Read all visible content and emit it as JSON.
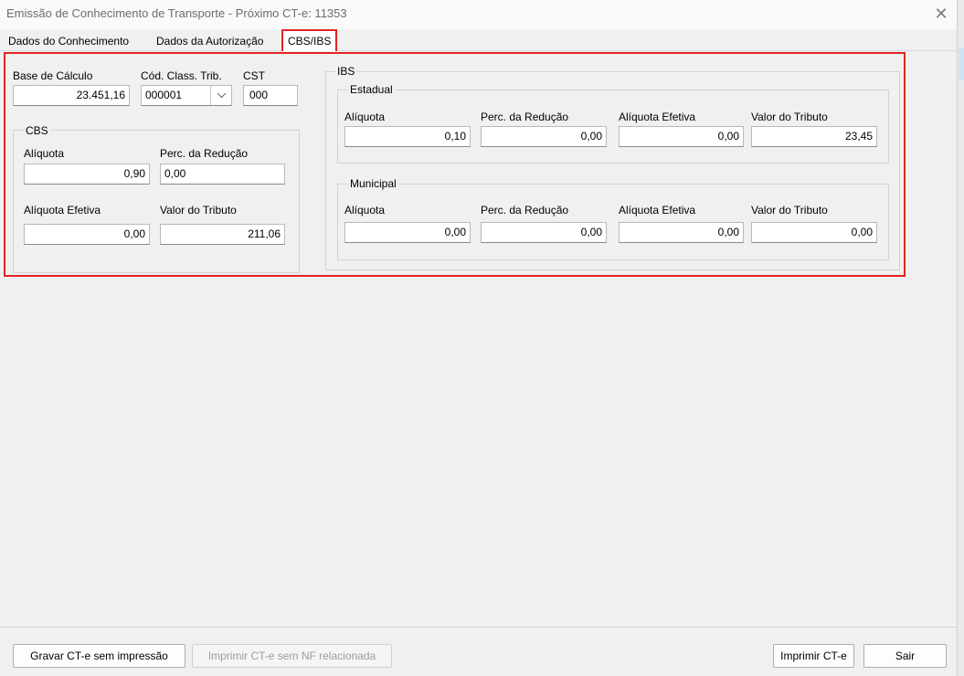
{
  "window": {
    "title": "Emissão de Conhecimento de Transporte - Próximo CT-e: 11353",
    "close_glyph": "✕"
  },
  "tabs": [
    {
      "label": "Dados do Conhecimento"
    },
    {
      "label": "Dados da Autorização"
    },
    {
      "label": "CBS/IBS",
      "active": true
    }
  ],
  "header_fields": {
    "base_label": "Base de Cálculo",
    "base_value": "23.451,16",
    "class_label": "Cód. Class. Trib.",
    "class_value": "000001",
    "cst_label": "CST",
    "cst_value": "000"
  },
  "cbs": {
    "caption": "CBS",
    "aliquota_label": "Alíquota",
    "aliquota_value": "0,90",
    "reducao_label": "Perc. da Redução",
    "reducao_value": "0,00",
    "efetiva_label": "Alíquota Efetiva",
    "efetiva_value": "0,00",
    "valor_label": "Valor do Tributo",
    "valor_value": "211,06"
  },
  "ibs": {
    "caption": "IBS",
    "estadual": {
      "caption": "Estadual",
      "aliquota_label": "Alíquota",
      "aliquota_value": "0,10",
      "reducao_label": "Perc. da Redução",
      "reducao_value": "0,00",
      "efetiva_label": "Alíquota Efetiva",
      "efetiva_value": "0,00",
      "valor_label": "Valor do Tributo",
      "valor_value": "23,45"
    },
    "municipal": {
      "caption": "Municipal",
      "aliquota_label": "Alíquota",
      "aliquota_value": "0,00",
      "reducao_label": "Perc. da Redução",
      "reducao_value": "0,00",
      "efetiva_label": "Alíquota Efetiva",
      "efetiva_value": "0,00",
      "valor_label": "Valor do Tributo",
      "valor_value": "0,00"
    }
  },
  "footer": {
    "gravar_label": "Gravar CT-e sem impressão",
    "imprimir_sem_nf_label": "Imprimir CT-e sem NF relacionada",
    "imprimir_label": "Imprimir CT-e",
    "sair_label": "Sair"
  },
  "colors": {
    "highlight": "#e32222"
  }
}
